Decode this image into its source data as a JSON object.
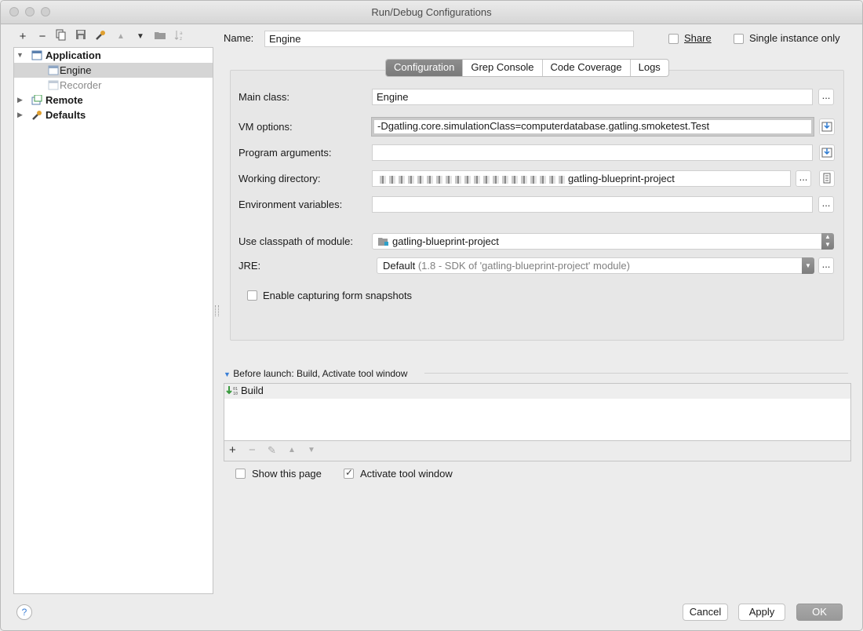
{
  "window": {
    "title": "Run/Debug Configurations"
  },
  "toolbar": {
    "add": "+",
    "remove": "−",
    "copy": "copy-icon",
    "save": "save-icon",
    "edit_defaults": "wrench-icon",
    "move_up": "▲",
    "move_down": "▼",
    "folder": "folder-icon",
    "sort": "sort-icon"
  },
  "tree": {
    "application": "Application",
    "engine": "Engine",
    "recorder": "Recorder",
    "remote": "Remote",
    "defaults": "Defaults"
  },
  "name_row": {
    "label": "Name:",
    "value": "Engine",
    "share": "Share",
    "single_instance": "Single instance only"
  },
  "tabs": [
    "Configuration",
    "Grep Console",
    "Code Coverage",
    "Logs"
  ],
  "config": {
    "main_class_label": "Main class:",
    "main_class_value": "Engine",
    "vm_options_label": "VM options:",
    "vm_options_value": "-Dgatling.core.simulationClass=computerdatabase.gatling.smoketest.Test",
    "program_args_label": "Program arguments:",
    "program_args_value": "",
    "working_dir_label": "Working directory:",
    "working_dir_value": "gatling-blueprint-project",
    "env_vars_label": "Environment variables:",
    "env_vars_value": "",
    "classpath_label": "Use classpath of module:",
    "classpath_value": "gatling-blueprint-project",
    "jre_label": "JRE:",
    "jre_default": "Default",
    "jre_detail": "(1.8 - SDK of 'gatling-blueprint-project' module)",
    "snapshots_label": "Enable capturing form snapshots",
    "browse": "..."
  },
  "before_launch": {
    "header": "Before launch: Build, Activate tool window",
    "items": [
      "Build"
    ],
    "toolbar": [
      "+",
      "−",
      "✎",
      "▲",
      "▼"
    ]
  },
  "options": {
    "show_page": "Show this page",
    "activate_tool_window": "Activate tool window"
  },
  "buttons": {
    "cancel": "Cancel",
    "apply": "Apply",
    "ok": "OK",
    "help": "?"
  }
}
